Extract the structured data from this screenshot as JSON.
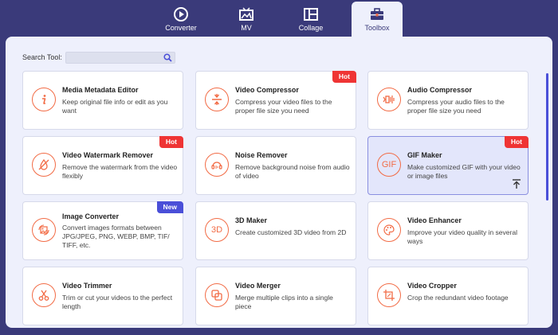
{
  "nav": {
    "tabs": [
      {
        "label": "Converter",
        "icon": "converter-icon"
      },
      {
        "label": "MV",
        "icon": "mv-icon"
      },
      {
        "label": "Collage",
        "icon": "collage-icon"
      },
      {
        "label": "Toolbox",
        "icon": "toolbox-icon",
        "active": true
      }
    ]
  },
  "search": {
    "label": "Search Tool:",
    "value": "",
    "placeholder": ""
  },
  "tools": [
    {
      "title": "Media Metadata Editor",
      "desc": "Keep original file info or edit as you want",
      "icon": "info-icon",
      "badge": ""
    },
    {
      "title": "Video Compressor",
      "desc": "Compress your video files to the proper file size you need",
      "icon": "compress-icon",
      "badge": "Hot"
    },
    {
      "title": "Audio Compressor",
      "desc": "Compress your audio files to the proper file size you need",
      "icon": "audio-compress-icon",
      "badge": ""
    },
    {
      "title": "Video Watermark Remover",
      "desc": "Remove the watermark from the video flexibly",
      "icon": "watermark-remove-icon",
      "badge": "Hot"
    },
    {
      "title": "Noise Remover",
      "desc": "Remove background noise from audio of video",
      "icon": "noise-remove-icon",
      "badge": ""
    },
    {
      "title": "GIF Maker",
      "desc": "Make customized GIF with your video or image files",
      "icon": "gif-icon",
      "icon_text": "GIF",
      "badge": "Hot",
      "selected": true
    },
    {
      "title": "Image Converter",
      "desc": "Convert images formats between JPG/JPEG, PNG, WEBP, BMP, TIF/ TIFF, etc.",
      "icon": "image-convert-icon",
      "badge": "New"
    },
    {
      "title": "3D Maker",
      "desc": "Create customized 3D video from 2D",
      "icon": "3d-icon",
      "icon_text": "3D",
      "badge": ""
    },
    {
      "title": "Video Enhancer",
      "desc": "Improve your video quality in several ways",
      "icon": "palette-icon",
      "badge": ""
    },
    {
      "title": "Video Trimmer",
      "desc": "Trim or cut your videos to the perfect length",
      "icon": "scissors-icon",
      "badge": ""
    },
    {
      "title": "Video Merger",
      "desc": "Merge multiple clips into a single piece",
      "icon": "merge-icon",
      "badge": ""
    },
    {
      "title": "Video Cropper",
      "desc": "Crop the redundant video footage",
      "icon": "crop-icon",
      "badge": ""
    }
  ],
  "colors": {
    "accent": "#f26b45",
    "nav_bg": "#3a3a7a",
    "panel_bg": "#eef0fc",
    "hot": "#ef3434",
    "new": "#4a4fd8"
  }
}
